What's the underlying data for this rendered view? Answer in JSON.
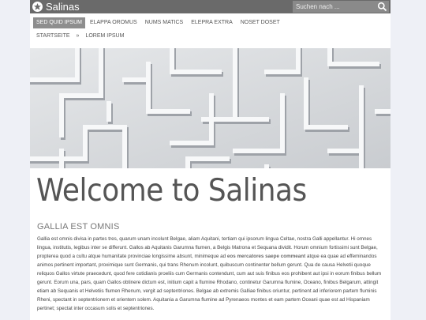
{
  "header": {
    "site_title": "Salinas",
    "search_placeholder": "Suchen nach ..."
  },
  "nav": {
    "items": [
      {
        "label": "SED QUID IPSUM",
        "active": true
      },
      {
        "label": "ELAPPA OROMUS",
        "active": false
      },
      {
        "label": "NUMS MATICS",
        "active": false
      },
      {
        "label": "ELEPRA EXTRA",
        "active": false
      },
      {
        "label": "NOSET DOSET",
        "active": false
      }
    ]
  },
  "breadcrumb": {
    "home": "STARTSEITE",
    "separator": "»",
    "current": "LOREM IPSUM"
  },
  "main": {
    "heading": "Welcome to Salinas",
    "subheading": "GALLIA EST OMNIS",
    "body_part1": "Gallia est omnis divisa in partes tres, quarum unam incolunt Belgae, aliam Aquitani, tertiam qui ipsorum lingua Celtae, nostra Galli appellantur. Hi omnes lingua, institutis, legibus inter se differunt. Gallos ab Aquitanis Garumna flumen, a Belgis Matrona et Sequana dividit. Horum omnium fortissimi sunt Belgae, propterea quod a cultu atque humanitate provinciae longissime absunt, minimeque ad ",
    "body_link": "eos mercatores saepe commeant",
    "body_part2": " atque ea quae ad effeminandos animos pertinent important, proximique sunt Germanis, qui trans Rhenum incolunt, quibuscum continenter bellum gerunt. Qua de causa Helvetii quoque reliquos Gallos virtute praecedunt, quod fere cotidianis proeliis cum Germanis contendunt, cum aut suis finibus eos prohibent aut ipsi in eorum finibus bellum gerunt. Eorum una, pars, quam Gallos obtinere dictum est, initium capit a flumine Rhodano, continetur Garumna flumine, Oceano, finibus Belgarum, attingit etiam ab Sequanis et Helvetiis flumen Rhenum, vergit ad septentriones. Belgae ab extremis Galliae finibus oriuntur, pertinent ad inferiorem partem fluminis Rheni, spectant in septentrionem et orientem solem. Aquitania a Garumna flumine ad Pyrenaeos montes et eam partem Oceani quae est ad Hispaniam pertinet; spectat inter occasum solis et septentriones."
  },
  "icons": {
    "logo": "star-circle-icon",
    "search": "search-icon"
  },
  "colors": {
    "topbar": "#6a6a6a",
    "nav_active": "#8e8e8e",
    "page_bg": "#eef0f6"
  }
}
